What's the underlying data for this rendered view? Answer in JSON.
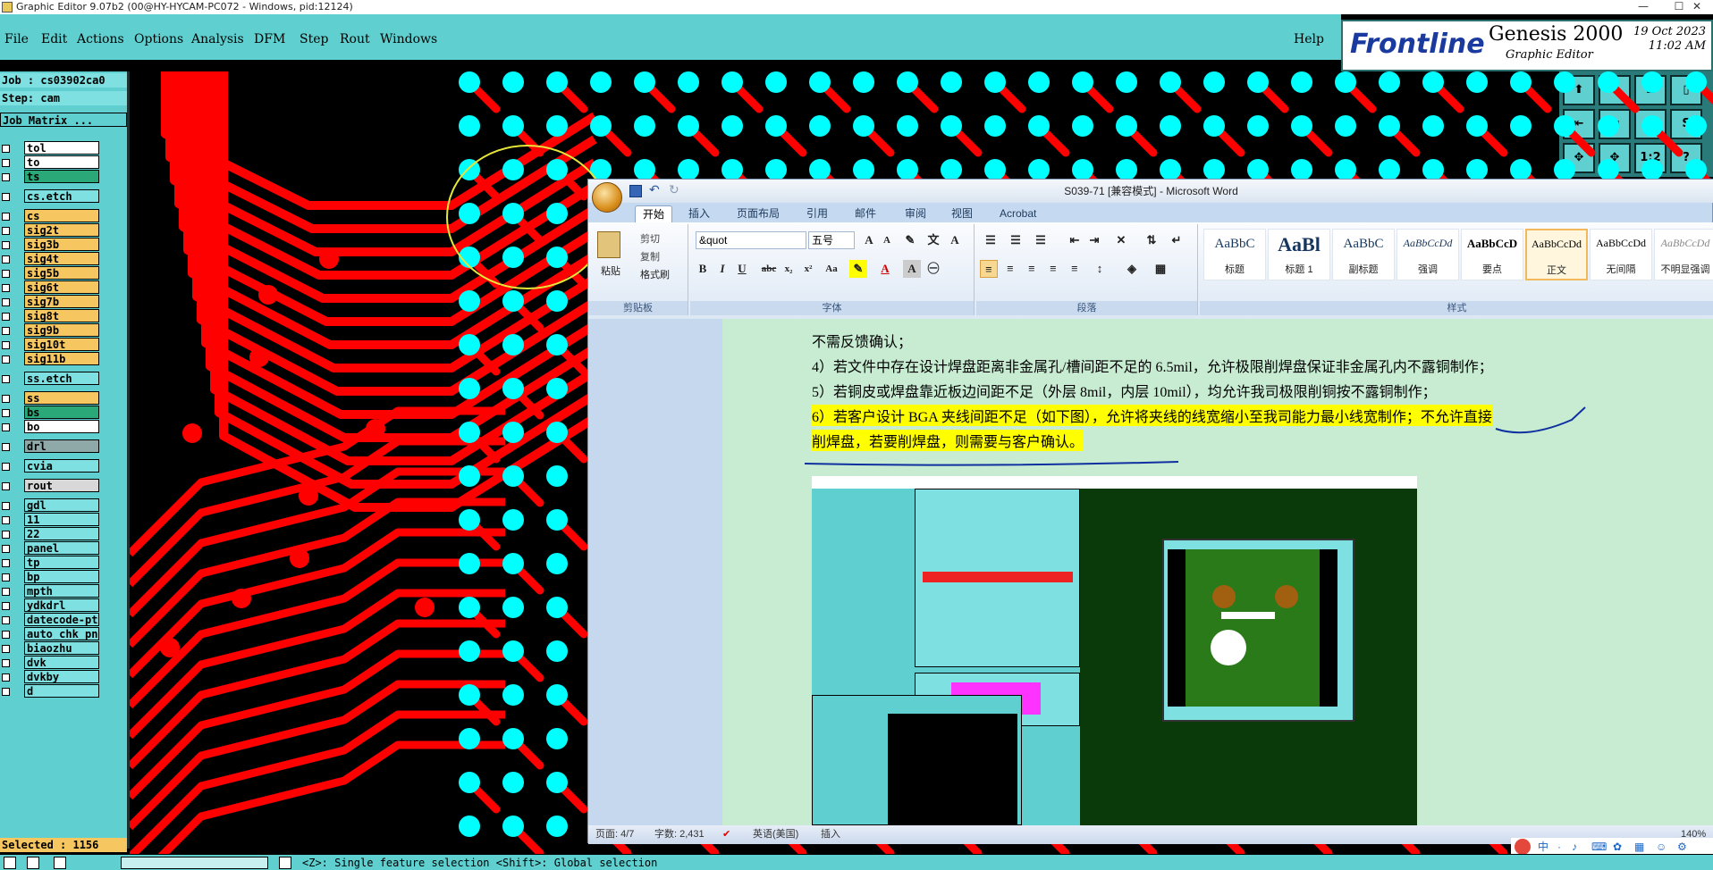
{
  "window": {
    "title": "Graphic Editor 9.07b2 (00@HY-HYCAM-PC072 - Windows, pid:12124)",
    "minimize": "—",
    "maximize": "☐",
    "close": "✕"
  },
  "menu": {
    "items": [
      {
        "label": "File"
      },
      {
        "label": "Edit"
      },
      {
        "label": "Actions"
      },
      {
        "label": "Options"
      },
      {
        "label": "Analysis"
      },
      {
        "label": "DFM"
      },
      {
        "label": "Step"
      },
      {
        "label": "Rout"
      },
      {
        "label": "Windows"
      }
    ],
    "help": "Help"
  },
  "brand": {
    "logo": "Frontline",
    "product": "Genesis 2000",
    "subtitle": "Graphic Editor",
    "date": "19 Oct 2023",
    "time": "11:02 AM"
  },
  "right_tools": [
    "⬆",
    "⬇",
    "⌂",
    "▯",
    "⇤",
    "⇥",
    "↹",
    "S",
    "✥",
    "✥",
    "1:2",
    "?"
  ],
  "left_panel": {
    "job": "Job : cs03902ca0",
    "step": "Step: cam",
    "job_matrix": "Job Matrix ...",
    "layers": [
      {
        "name": "tol",
        "color": "#ffffff"
      },
      {
        "name": "to",
        "color": "#ffffff"
      },
      {
        "name": "ts",
        "color": "#2aa878"
      },
      {
        "name": "cs.etch",
        "color": "#7ee0e0"
      },
      {
        "name": "cs",
        "color": "#f6c660"
      },
      {
        "name": "sig2t",
        "color": "#f6c660"
      },
      {
        "name": "sig3b",
        "color": "#f6c660"
      },
      {
        "name": "sig4t",
        "color": "#f6c660"
      },
      {
        "name": "sig5b",
        "color": "#f6c660"
      },
      {
        "name": "sig6t",
        "color": "#f6c660"
      },
      {
        "name": "sig7b",
        "color": "#f6c660"
      },
      {
        "name": "sig8t",
        "color": "#f6c660"
      },
      {
        "name": "sig9b",
        "color": "#f6c660"
      },
      {
        "name": "sig10t",
        "color": "#f6c660"
      },
      {
        "name": "sig11b",
        "color": "#f6c660"
      },
      {
        "name": "ss.etch",
        "color": "#7ee0e0"
      },
      {
        "name": "ss",
        "color": "#f6c660"
      },
      {
        "name": "bs",
        "color": "#2aa878"
      },
      {
        "name": "bo",
        "color": "#ffffff"
      },
      {
        "name": "drl",
        "color": "#8fa8a8"
      },
      {
        "name": "cvia",
        "color": "#7ee0e0"
      },
      {
        "name": "rout",
        "color": "#d8d8d8"
      },
      {
        "name": "gdl",
        "color": "#7ee0e0"
      },
      {
        "name": "11",
        "color": "#7ee0e0"
      },
      {
        "name": "22",
        "color": "#7ee0e0"
      },
      {
        "name": "panel",
        "color": "#7ee0e0"
      },
      {
        "name": "tp",
        "color": "#7ee0e0"
      },
      {
        "name": "bp",
        "color": "#7ee0e0"
      },
      {
        "name": "mpth",
        "color": "#7ee0e0"
      },
      {
        "name": "ydkdrl",
        "color": "#7ee0e0"
      },
      {
        "name": "datecode-pte",
        "color": "#7ee0e0"
      },
      {
        "name": "auto_chk_pn",
        "color": "#7ee0e0"
      },
      {
        "name": "biaozhu",
        "color": "#7ee0e0"
      },
      {
        "name": "dvk",
        "color": "#7ee0e0"
      },
      {
        "name": "dvkby",
        "color": "#7ee0e0"
      },
      {
        "name": "d",
        "color": "#7ee0e0"
      }
    ],
    "selected": "Selected : 1156"
  },
  "status": {
    "text": "<Z>: Single feature selection  <Shift>: Global selection"
  },
  "word": {
    "title": "S039-71 [兼容模式] - Microsoft Word",
    "tabs": [
      "开始",
      "插入",
      "页面布局",
      "引用",
      "邮件",
      "审阅",
      "视图",
      "Acrobat"
    ],
    "clipboard": {
      "paste": "粘贴",
      "cut": "剪切",
      "copy": "复制",
      "format_painter": "格式刷",
      "group": "剪贴板"
    },
    "font": {
      "name": "&quot",
      "size": "五号",
      "group": "字体"
    },
    "paragraph_group": "段落",
    "styles": [
      {
        "sample": "AaBbC",
        "name": "标题"
      },
      {
        "sample": "AaBl",
        "name": "标题 1"
      },
      {
        "sample": "AaBbC",
        "name": "副标题"
      },
      {
        "sample": "AaBbCcDd",
        "name": "强调"
      },
      {
        "sample": "AaBbCcD",
        "name": "要点"
      },
      {
        "sample": "AaBbCcDd",
        "name": "正文"
      },
      {
        "sample": "AaBbCcDd",
        "name": "无间隔"
      },
      {
        "sample": "AaBbCcDd",
        "name": "不明显强调"
      }
    ],
    "styles_group": "样式",
    "lines": [
      "不需反馈确认；",
      "4）若文件中存在设计焊盘距离非金属孔/槽间距不足的 6.5mil，允许极限削焊盘保证非金属孔内不露铜制作；",
      "5）若铜皮或焊盘靠近板边间距不足（外层 8mil，内层 10mil），均允许我司极限削铜按不露铜制作；",
      "6）若客户设计 BGA 夹线间距不足（如下图），允许将夹线的线宽缩小至我司能力最小线宽制作；不允许直接",
      "削焊盘，若要削焊盘，则需要与客户确认。"
    ],
    "status": {
      "page": "页面: 4/7",
      "words": "字数: 2,431",
      "lang": "英语(美国)",
      "mode": "插入",
      "zoom": "140%"
    }
  }
}
